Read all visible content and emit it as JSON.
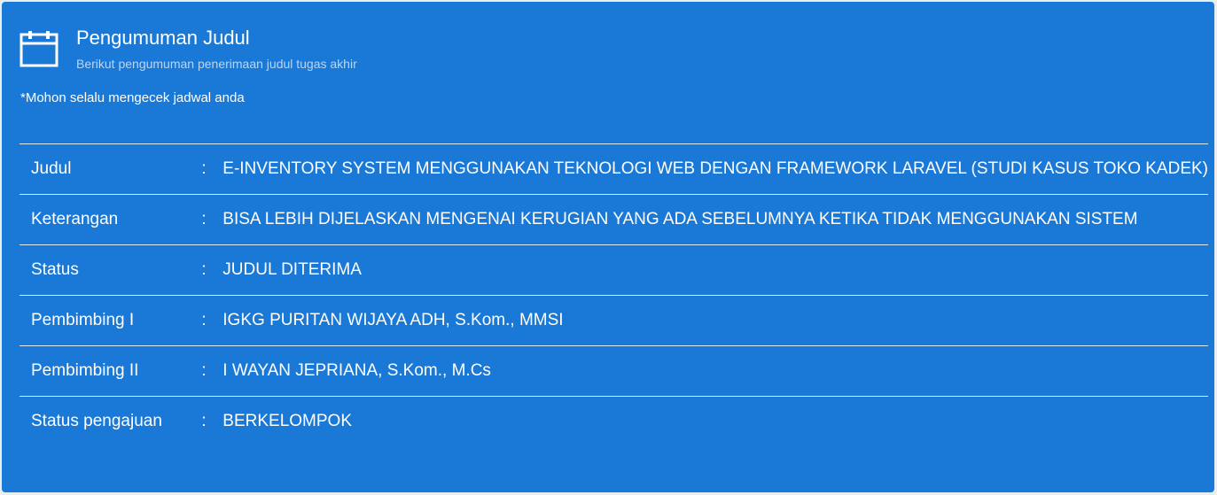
{
  "card": {
    "title": "Pengumuman Judul",
    "subtitle": "Berikut pengumuman penerimaan judul tugas akhir",
    "note": "*Mohon selalu mengecek jadwal anda",
    "icon": "calendar-icon"
  },
  "rows": [
    {
      "label": "Judul",
      "colon": ":",
      "value": "E-INVENTORY SYSTEM MENGGUNAKAN TEKNOLOGI WEB DENGAN FRAMEWORK LARAVEL (STUDI KASUS TOKO KADEK)"
    },
    {
      "label": "Keterangan",
      "colon": ":",
      "value": "BISA LEBIH DIJELASKAN MENGENAI KERUGIAN YANG ADA SEBELUMNYA KETIKA TIDAK MENGGUNAKAN SISTEM"
    },
    {
      "label": "Status",
      "colon": ":",
      "value": "JUDUL DITERIMA"
    },
    {
      "label": "Pembimbing I",
      "colon": ":",
      "value": "IGKG PURITAN WIJAYA ADH, S.Kom., MMSI"
    },
    {
      "label": "Pembimbing II",
      "colon": ":",
      "value": "I WAYAN JEPRIANA, S.Kom., M.Cs"
    },
    {
      "label": "Status pengajuan",
      "colon": ":",
      "value": "BERKELOMPOK"
    }
  ],
  "colors": {
    "card_background": "#1a78d6",
    "subtitle": "#b8d6f5",
    "text": "#ffffff"
  }
}
